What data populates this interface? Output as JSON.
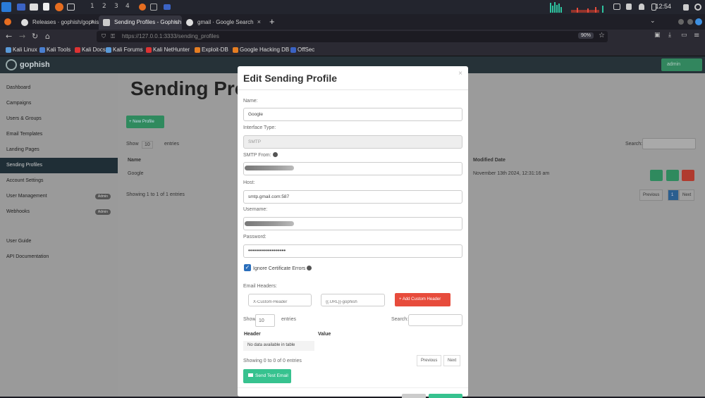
{
  "os": {
    "workspaces": [
      "1",
      "2",
      "3",
      "4"
    ],
    "clock": "12:54"
  },
  "tabs": [
    {
      "label": "Releases · gophish/gophish"
    },
    {
      "label": "Sending Profiles - Gophish"
    },
    {
      "label": "gmail · Google Search"
    }
  ],
  "nav": {
    "url": "https://127.0.0.1:3333/sending_profiles",
    "zoom": "90%"
  },
  "bookmarks": [
    "Kali Linux",
    "Kali Tools",
    "Kali Docs",
    "Kali Forums",
    "Kali NetHunter",
    "Exploit-DB",
    "Google Hacking DB",
    "OffSec"
  ],
  "app": {
    "name": "gophish",
    "admin_label": "admin"
  },
  "sidebar": {
    "items": [
      {
        "label": "Dashboard"
      },
      {
        "label": "Campaigns"
      },
      {
        "label": "Users & Groups"
      },
      {
        "label": "Email Templates"
      },
      {
        "label": "Landing Pages"
      },
      {
        "label": "Sending Profiles"
      },
      {
        "label": "Account Settings"
      },
      {
        "label": "User Management",
        "badge": "Admin"
      },
      {
        "label": "Webhooks",
        "badge": "Admin"
      },
      {
        "label": "User Guide"
      },
      {
        "label": "API Documentation"
      }
    ]
  },
  "main": {
    "title": "Sending Profiles",
    "new_profile": "+ New Profile",
    "show": "Show",
    "entries_count": "10",
    "entries": "entries",
    "search": "Search:",
    "col_name": "Name",
    "col_modified": "Modified Date",
    "row_name": "Google",
    "row_date": "November 13th 2024, 12:31:16 am",
    "showing": "Showing 1 to 1 of 1 entries",
    "previous": "Previous",
    "page": "1",
    "next": "Next"
  },
  "modal": {
    "title": "Edit Sending Profile",
    "close": "×",
    "name_label": "Name:",
    "name_value": "Google",
    "interface_label": "Interface Type:",
    "interface_value": "SMTP",
    "smtp_from_label": "SMTP From:",
    "host_label": "Host:",
    "host_value": "smtp.gmail.com:587",
    "username_label": "Username:",
    "password_label": "Password:",
    "password_value": "•••••••••••••••••••",
    "ignore_cert": "Ignore Certificate Errors",
    "email_headers": "Email Headers:",
    "header_placeholder": "X-Custom-Header",
    "value_placeholder": "{{.URL}}-gophish",
    "add_header": "+ Add Custom Header",
    "show": "Show",
    "entries_count": "10",
    "entries": "entries",
    "search": "Search:",
    "col_header": "Header",
    "col_value": "Value",
    "no_data": "No data available in table",
    "showing": "Showing 0 to 0 of 0 entries",
    "previous": "Previous",
    "next": "Next",
    "send_test": "Send Test Email"
  }
}
